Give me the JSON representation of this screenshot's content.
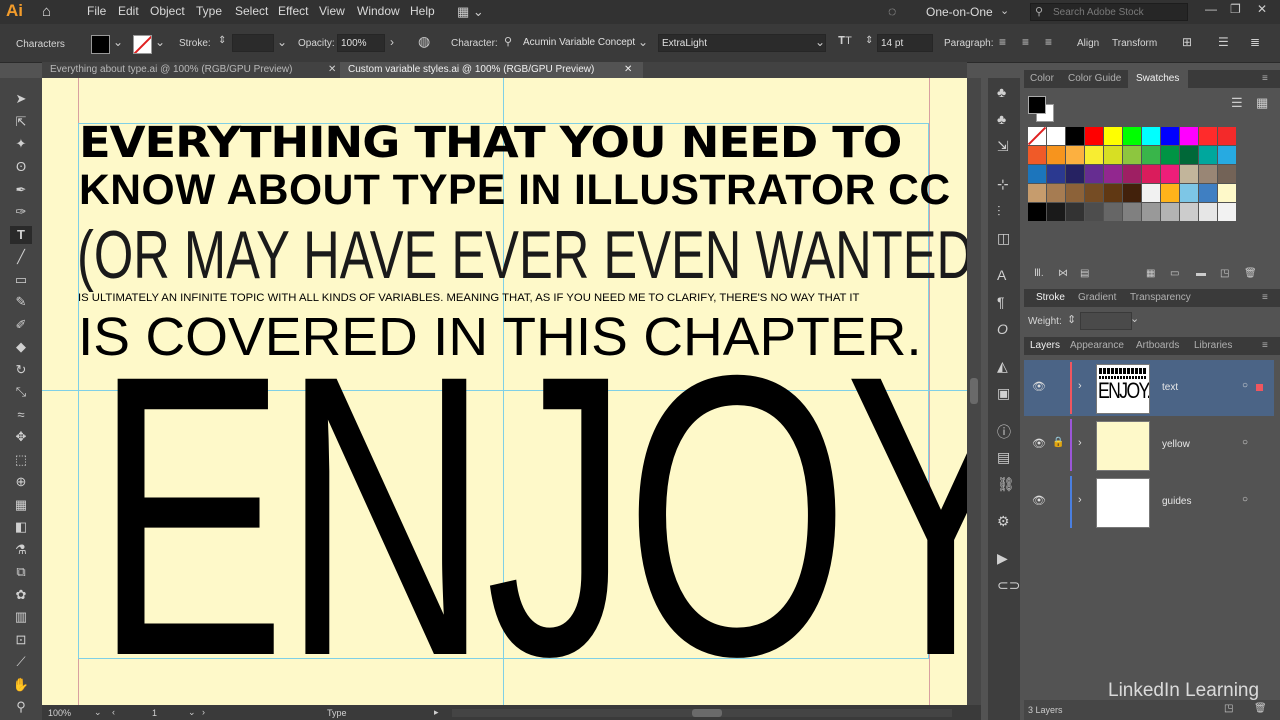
{
  "app": {
    "logo": "Ai"
  },
  "menu": [
    "File",
    "Edit",
    "Object",
    "Type",
    "Select",
    "Effect",
    "View",
    "Window",
    "Help"
  ],
  "workspace": {
    "label": "One-on-One",
    "search_placeholder": "Search Adobe Stock"
  },
  "control": {
    "mode_label": "Characters",
    "stroke_label": "Stroke:",
    "opacity_label": "Opacity:",
    "opacity_value": "100%",
    "character_label": "Character:",
    "font_family": "Acumin Variable Concept",
    "font_style": "ExtraLight",
    "font_size": "14 pt",
    "paragraph_label": "Paragraph:",
    "align_label": "Align",
    "transform_label": "Transform"
  },
  "tabs": [
    {
      "label": "Everything about type.ai @ 100% (RGB/GPU Preview)",
      "close": "✕"
    },
    {
      "label": "Custom variable styles.ai @ 100% (RGB/GPU Preview)",
      "close": "✕"
    }
  ],
  "artboard": {
    "line1": "EVERYTHING THAT YOU NEED TO",
    "line2": "KNOW ABOUT TYPE IN ILLUSTRATOR CC",
    "line3": "(OR MAY HAVE EVER EVEN WANTED TO KNOW)",
    "line4": "IS ULTIMATELY AN INFINITE TOPIC WITH ALL KINDS OF VARIABLES. MEANING THAT, AS IF YOU NEED ME TO CLARIFY, THERE'S NO WAY THAT IT",
    "line5": "IS COVERED IN THIS CHAPTER.",
    "line6": "ENJOY."
  },
  "status": {
    "zoom": "100%",
    "artboard_number": "1",
    "tool_name": "Type"
  },
  "panels": {
    "top_tabs": [
      "Color",
      "Color Guide",
      "Swatches"
    ],
    "stroke_tabs": [
      "Stroke",
      "Gradient",
      "Transparency"
    ],
    "weight_label": "Weight:",
    "layers_tabs": [
      "Layers",
      "Appearance",
      "Artboards",
      "Libraries"
    ],
    "layers": [
      {
        "name": "text",
        "thumb_text": "ENJOY.",
        "color": "#f0565f"
      },
      {
        "name": "yellow",
        "color": "#9b56d8"
      },
      {
        "name": "guides",
        "color": "#4a7fe0"
      }
    ],
    "layers_count": "3 Layers"
  },
  "swatches": {
    "row1": [
      "#ffffff",
      "#ffffff",
      "#000000",
      "#ff0000",
      "#ffff00",
      "#00ff00",
      "#00ffff",
      "#0000ff",
      "#ff00ff",
      "#ff2b2b",
      "#f32a2a"
    ],
    "row2": [
      "#f05a28",
      "#f7941d",
      "#fcb040",
      "#f8ed31",
      "#d7df23",
      "#8dc63f",
      "#39b54a",
      "#009444",
      "#006838",
      "#00a79d",
      "#27aae1"
    ],
    "row3": [
      "#1c75bc",
      "#2b3990",
      "#262262",
      "#662d91",
      "#92278f",
      "#9e1f63",
      "#da1c5c",
      "#ed1e79",
      "#c2b59b",
      "#998675",
      "#736357"
    ],
    "row4": [
      "#c69c6d",
      "#a67c52",
      "#8c6239",
      "#754c24",
      "#603813",
      "#42210b",
      "#f1f1f1",
      "#ffb31a",
      "#7dc6e6",
      "#3f7fc2",
      "#fef9c9"
    ],
    "row5": [
      "#000000",
      "#1a1a1a",
      "#333333",
      "#4d4d4d",
      "#666666",
      "#808080",
      "#999999",
      "#b3b3b3",
      "#cccccc",
      "#e6e6e6",
      "#f2f2f2"
    ]
  },
  "watermark": "LinkedIn Learning"
}
